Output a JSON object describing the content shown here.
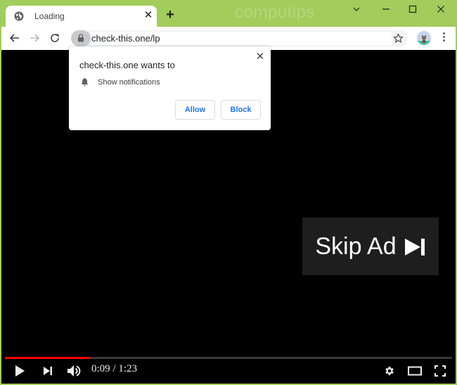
{
  "browser": {
    "tab": {
      "title": "Loading",
      "favicon": "globe-icon",
      "close_glyph": "✕"
    },
    "new_tab_glyph": "+",
    "watermark": "computips",
    "window_controls": [
      "chevron-down-icon",
      "minimize-icon",
      "maximize-icon",
      "close-icon"
    ],
    "toolbar": {
      "back": "back-arrow-icon",
      "forward": "forward-arrow-icon",
      "reload": "reload-icon",
      "lock": "lock-icon",
      "url": "check-this.one/lp",
      "bookmark": "star-icon",
      "profile": "avatar",
      "menu": "kebab-menu-icon"
    },
    "accent_color": "#a2cc5c"
  },
  "permission_prompt": {
    "heading": "check-this.one wants to",
    "permission_icon": "bell-icon",
    "permission_text": "Show notifications",
    "allow_label": "Allow",
    "block_label": "Block",
    "close_glyph": "✕",
    "button_text_color": "#1a73e8"
  },
  "video": {
    "skip_ad_label": "Skip Ad",
    "skip_ad_icon": "skip-next-icon",
    "current_time": "0:09",
    "duration": "1:23",
    "time_display": "0:09 / 1:23",
    "progress_fraction": 0.19,
    "progress_color": "#ff0000",
    "controls": {
      "left": [
        "play-icon",
        "next-icon",
        "volume-icon"
      ],
      "right": [
        "settings-icon",
        "theater-mode-icon",
        "fullscreen-icon"
      ]
    }
  }
}
